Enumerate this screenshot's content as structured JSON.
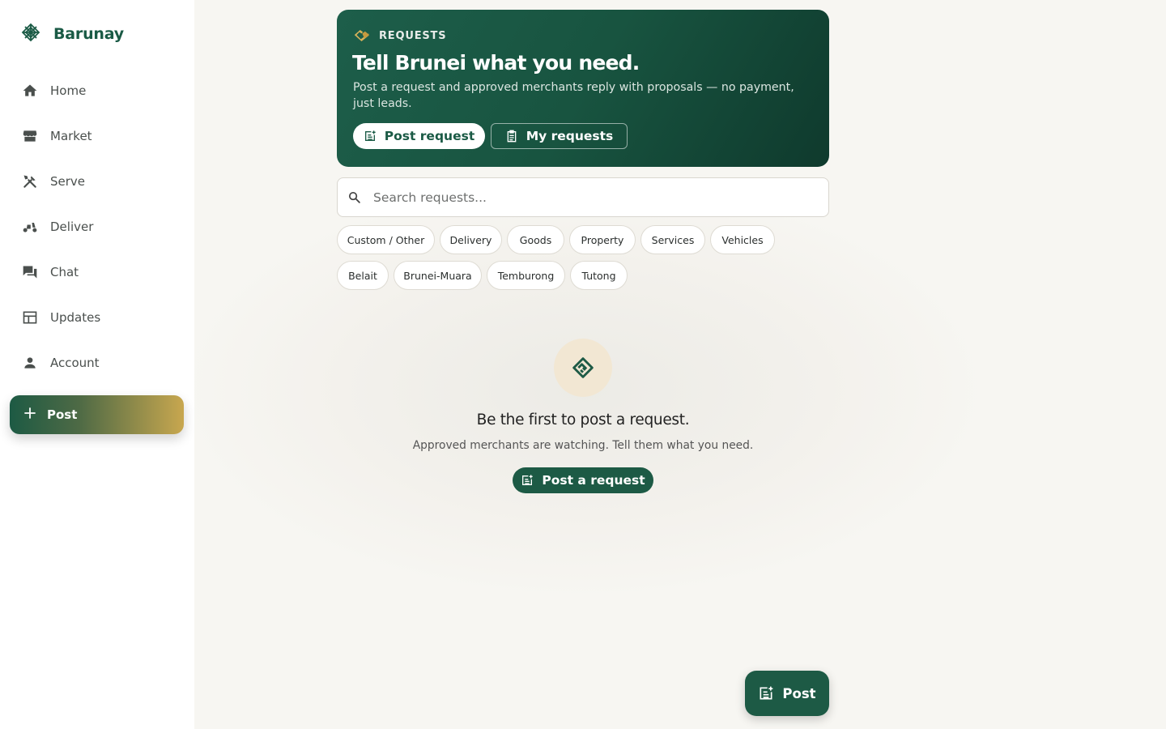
{
  "app": {
    "name": "Barunay"
  },
  "sidebar": {
    "items": [
      {
        "label": "Home",
        "icon": "home-icon"
      },
      {
        "label": "Market",
        "icon": "storefront-icon"
      },
      {
        "label": "Serve",
        "icon": "tools-icon"
      },
      {
        "label": "Deliver",
        "icon": "scooter-icon"
      },
      {
        "label": "Chat",
        "icon": "chat-icon"
      },
      {
        "label": "Updates",
        "icon": "newspaper-icon"
      },
      {
        "label": "Account",
        "icon": "person-icon"
      }
    ],
    "post_label": "Post"
  },
  "hero": {
    "tag": "REQUESTS",
    "title": "Tell Brunei what you need.",
    "subtitle": "Post a request and approved merchants reply with proposals — no payment, just leads.",
    "post_request_label": "Post request",
    "my_requests_label": "My requests"
  },
  "search": {
    "placeholder": "Search requests..."
  },
  "filters": {
    "categories": [
      "Custom / Other",
      "Delivery",
      "Goods",
      "Property",
      "Services",
      "Vehicles"
    ],
    "districts": [
      "Belait",
      "Brunei-Muara",
      "Temburong",
      "Tutong"
    ]
  },
  "empty_state": {
    "title": "Be the first to post a request.",
    "subtitle": "Approved merchants are watching. Tell them what you need.",
    "button_label": "Post a request"
  },
  "fab": {
    "label": "Post"
  },
  "colors": {
    "brand": "#1d5a45",
    "accent_gold": "#c8a74f",
    "hero_dark": "#0f3a2d"
  }
}
